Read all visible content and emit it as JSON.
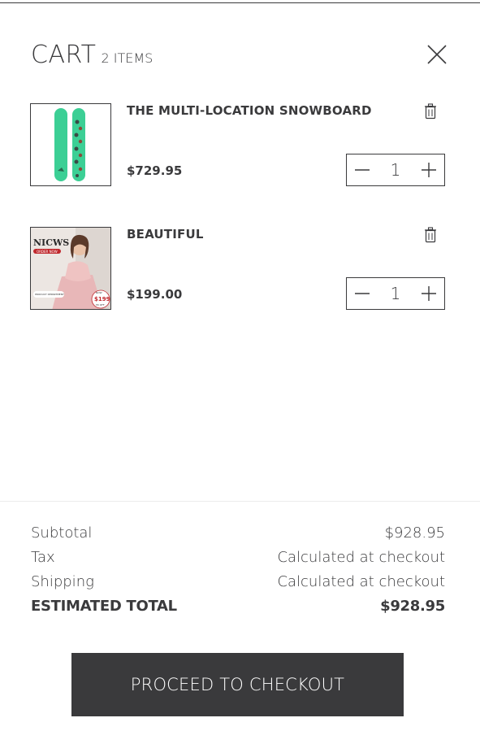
{
  "cart": {
    "title": "CART",
    "count_label": "2 ITEMS"
  },
  "items": [
    {
      "name": "THE MULTI-LOCATION SNOWBOARD",
      "price": "$729.95",
      "quantity": "1",
      "image_icon": "snowboard-image"
    },
    {
      "name": "BEAUTIFUL",
      "price": "$199.00",
      "quantity": "1",
      "image_icon": "dress-model-image",
      "image_text": {
        "brand": "NICWS",
        "banner": "ORDER NOW",
        "caption": "PRODUCT DEPARTMENT",
        "sticker_top": "NOW",
        "sticker_price": "$199",
        "sticker_bottom": "55 OFF"
      }
    }
  ],
  "summary": {
    "subtotal_label": "Subtotal",
    "subtotal_value": "$928.95",
    "tax_label": "Tax",
    "tax_value": "Calculated at checkout",
    "shipping_label": "Shipping",
    "shipping_value": "Calculated at checkout",
    "total_label": "ESTIMATED TOTAL",
    "total_value": "$928.95"
  },
  "checkout": {
    "label": "PROCEED TO CHECKOUT"
  },
  "colors": {
    "text": "#3a3a3c",
    "button_bg": "#3a3a3c",
    "snowboard_green": "#3ccf95"
  },
  "icons": [
    "close-icon",
    "trash-icon",
    "minus-icon",
    "plus-icon"
  ]
}
